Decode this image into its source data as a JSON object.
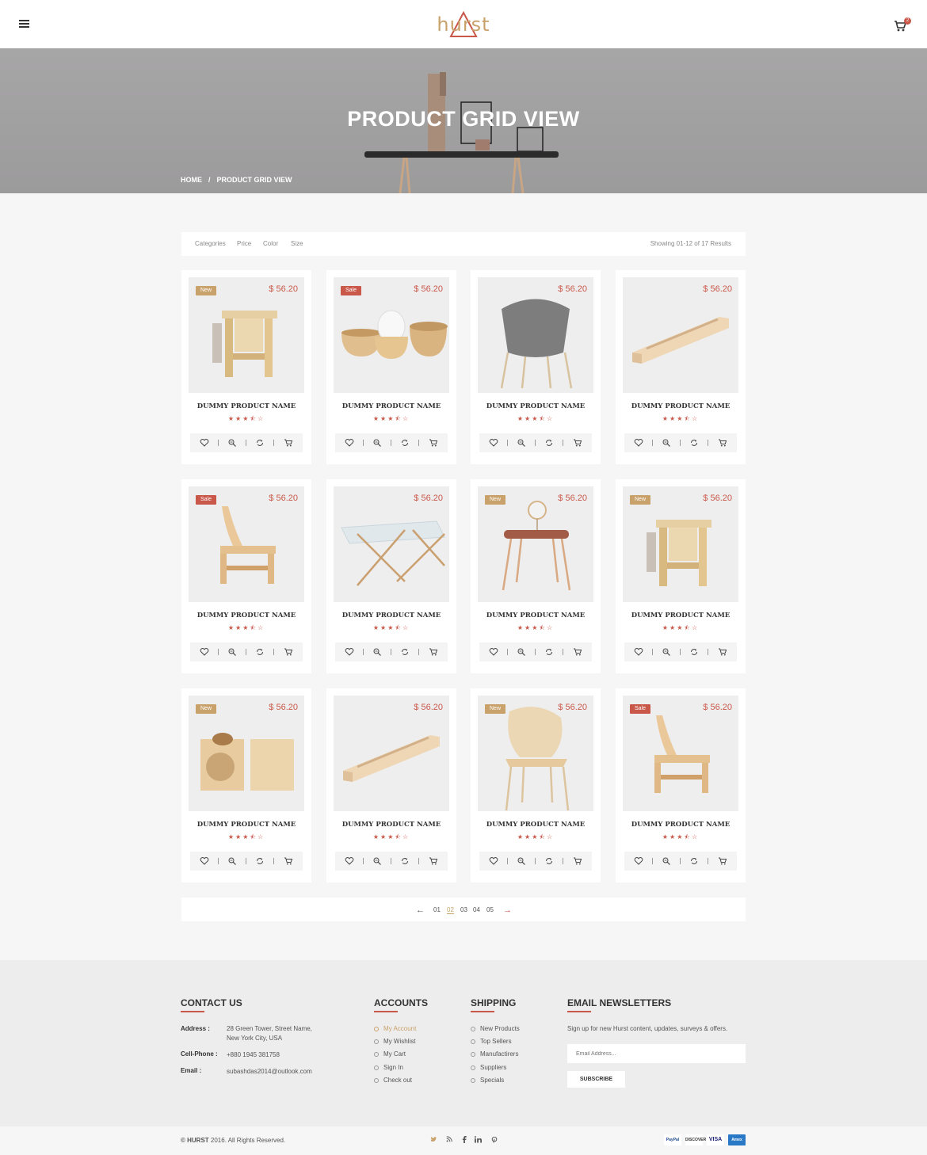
{
  "header": {
    "logo_text": "hurst",
    "cart_count": "2"
  },
  "hero": {
    "title": "PRODUCT GRID VIEW",
    "breadcrumb_home": "HOME",
    "breadcrumb_sep": "/",
    "breadcrumb_current": "PRODUCT GRID VIEW"
  },
  "filters": {
    "categories": "Categories",
    "price": "Price",
    "color": "Color",
    "size": "Size",
    "results": "Showing 01-12 of 17 Results"
  },
  "products": [
    {
      "name": "DUMMY PRODUCT NAME",
      "price": "$ 56.20",
      "badge": "New",
      "badge_type": "new",
      "image": "stool",
      "rating": 3.5
    },
    {
      "name": "DUMMY PRODUCT NAME",
      "price": "$ 56.20",
      "badge": "Sale",
      "badge_type": "sale",
      "image": "bowls",
      "rating": 3.5
    },
    {
      "name": "DUMMY PRODUCT NAME",
      "price": "$ 56.20",
      "badge": "",
      "badge_type": "",
      "image": "grey-chair",
      "rating": 3.5
    },
    {
      "name": "DUMMY PRODUCT NAME",
      "price": "$ 56.20",
      "badge": "",
      "badge_type": "",
      "image": "tray",
      "rating": 3.5
    },
    {
      "name": "DUMMY PRODUCT NAME",
      "price": "$ 56.20",
      "badge": "Sale",
      "badge_type": "sale",
      "image": "wood-chair",
      "rating": 3.5
    },
    {
      "name": "DUMMY PRODUCT NAME",
      "price": "$ 56.20",
      "badge": "",
      "badge_type": "",
      "image": "glass-table",
      "rating": 3.5
    },
    {
      "name": "DUMMY PRODUCT NAME",
      "price": "$ 56.20",
      "badge": "New",
      "badge_type": "new",
      "image": "vanity",
      "rating": 3.5
    },
    {
      "name": "DUMMY PRODUCT NAME",
      "price": "$ 56.20",
      "badge": "New",
      "badge_type": "new",
      "image": "stool",
      "rating": 3.5
    },
    {
      "name": "DUMMY PRODUCT NAME",
      "price": "$ 56.20",
      "badge": "New",
      "badge_type": "new",
      "image": "cubes",
      "rating": 3.5
    },
    {
      "name": "DUMMY PRODUCT NAME",
      "price": "$ 56.20",
      "badge": "",
      "badge_type": "",
      "image": "tray",
      "rating": 3.5
    },
    {
      "name": "DUMMY PRODUCT NAME",
      "price": "$ 56.20",
      "badge": "New",
      "badge_type": "new",
      "image": "round-chair",
      "rating": 3.5
    },
    {
      "name": "DUMMY PRODUCT NAME",
      "price": "$ 56.20",
      "badge": "Sale",
      "badge_type": "sale",
      "image": "wood-chair",
      "rating": 3.5
    }
  ],
  "product_actions": [
    "heart-icon",
    "zoom-icon",
    "compare-icon",
    "add-to-cart-icon"
  ],
  "pagination": {
    "pages": [
      "01",
      "02",
      "03",
      "04",
      "05"
    ],
    "active": "02",
    "prev": "←",
    "next": "→"
  },
  "footer": {
    "contact": {
      "heading": "CONTACT US",
      "address_label": "Address :",
      "address_line1": "28 Green Tower, Street Name,",
      "address_line2": "New York City, USA",
      "phone_label": "Cell-Phone :",
      "phone": "+880 1945 381758",
      "email_label": "Email :",
      "email": "subashdas2014@outlook.com"
    },
    "accounts": {
      "heading": "ACCOUNTS",
      "links": [
        "My Account",
        "My Wishlist",
        "My Cart",
        "Sign In",
        "Check out"
      ]
    },
    "shipping": {
      "heading": "SHIPPING",
      "links": [
        "New Products",
        "Top Sellers",
        "Manufactirers",
        "Suppliers",
        "Specials"
      ]
    },
    "newsletter": {
      "heading": "EMAIL NEWSLETTERS",
      "text": "Sign up for new Hurst content, updates, surveys & offers.",
      "placeholder": "Email Address...",
      "button": "SUBSCRIBE"
    },
    "copyright_brand": "© HURST",
    "copyright_rest": " 2016. All Rights Reserved.",
    "social": [
      "twitter-icon",
      "rss-icon",
      "facebook-icon",
      "linkedin-icon",
      "pinterest-icon"
    ],
    "payments": [
      "PayPal",
      "DISCOVER",
      "VISA",
      "Amex"
    ]
  },
  "colors": {
    "accent_red": "#c9574a",
    "accent_gold": "#c9a26b",
    "background": "#f6f6f6"
  }
}
